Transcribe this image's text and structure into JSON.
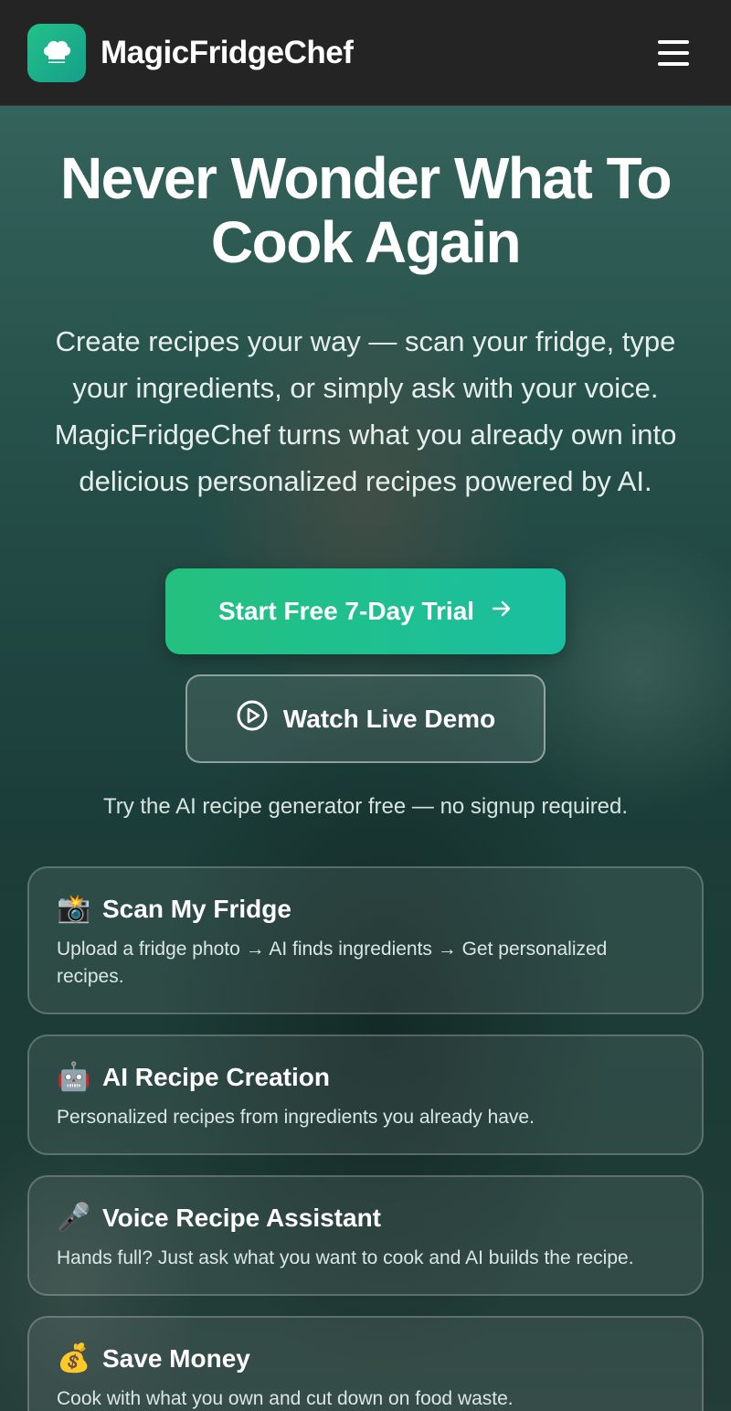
{
  "header": {
    "brand": "MagicFridgeChef",
    "logo_icon": "chef-hat-icon",
    "menu_icon": "hamburger-menu-icon"
  },
  "hero": {
    "headline": "Never Wonder What To Cook Again",
    "subtext": "Create recipes your way — scan your fridge, type your ingredients, or simply ask with your voice. MagicFridgeChef turns what you already own into delicious personalized recipes powered by AI.",
    "primary_cta": "Start Free 7-Day Trial",
    "primary_cta_icon": "→",
    "secondary_cta": "Watch Live Demo",
    "secondary_cta_icon": "play-circle-icon",
    "note": "Try the AI recipe generator free — no signup required."
  },
  "features": [
    {
      "emoji": "📸",
      "icon": "camera-flash-icon",
      "title": "Scan My Fridge",
      "desc": "Upload a fridge photo → AI finds ingredients → Get personalized recipes."
    },
    {
      "emoji": "🤖",
      "icon": "robot-icon",
      "title": "AI Recipe Creation",
      "desc": "Personalized recipes from ingredients you already have."
    },
    {
      "emoji": "🎤",
      "icon": "microphone-icon",
      "title": "Voice Recipe Assistant",
      "desc": "Hands full? Just ask what you want to cook and AI builds the recipe."
    },
    {
      "emoji": "💰",
      "icon": "money-bag-icon",
      "title": "Save Money",
      "desc": "Cook with what you own and cut down on food waste."
    }
  ],
  "colors": {
    "accent_start": "#24c07f",
    "accent_end": "#1abfa0",
    "header_bg": "#232423"
  }
}
